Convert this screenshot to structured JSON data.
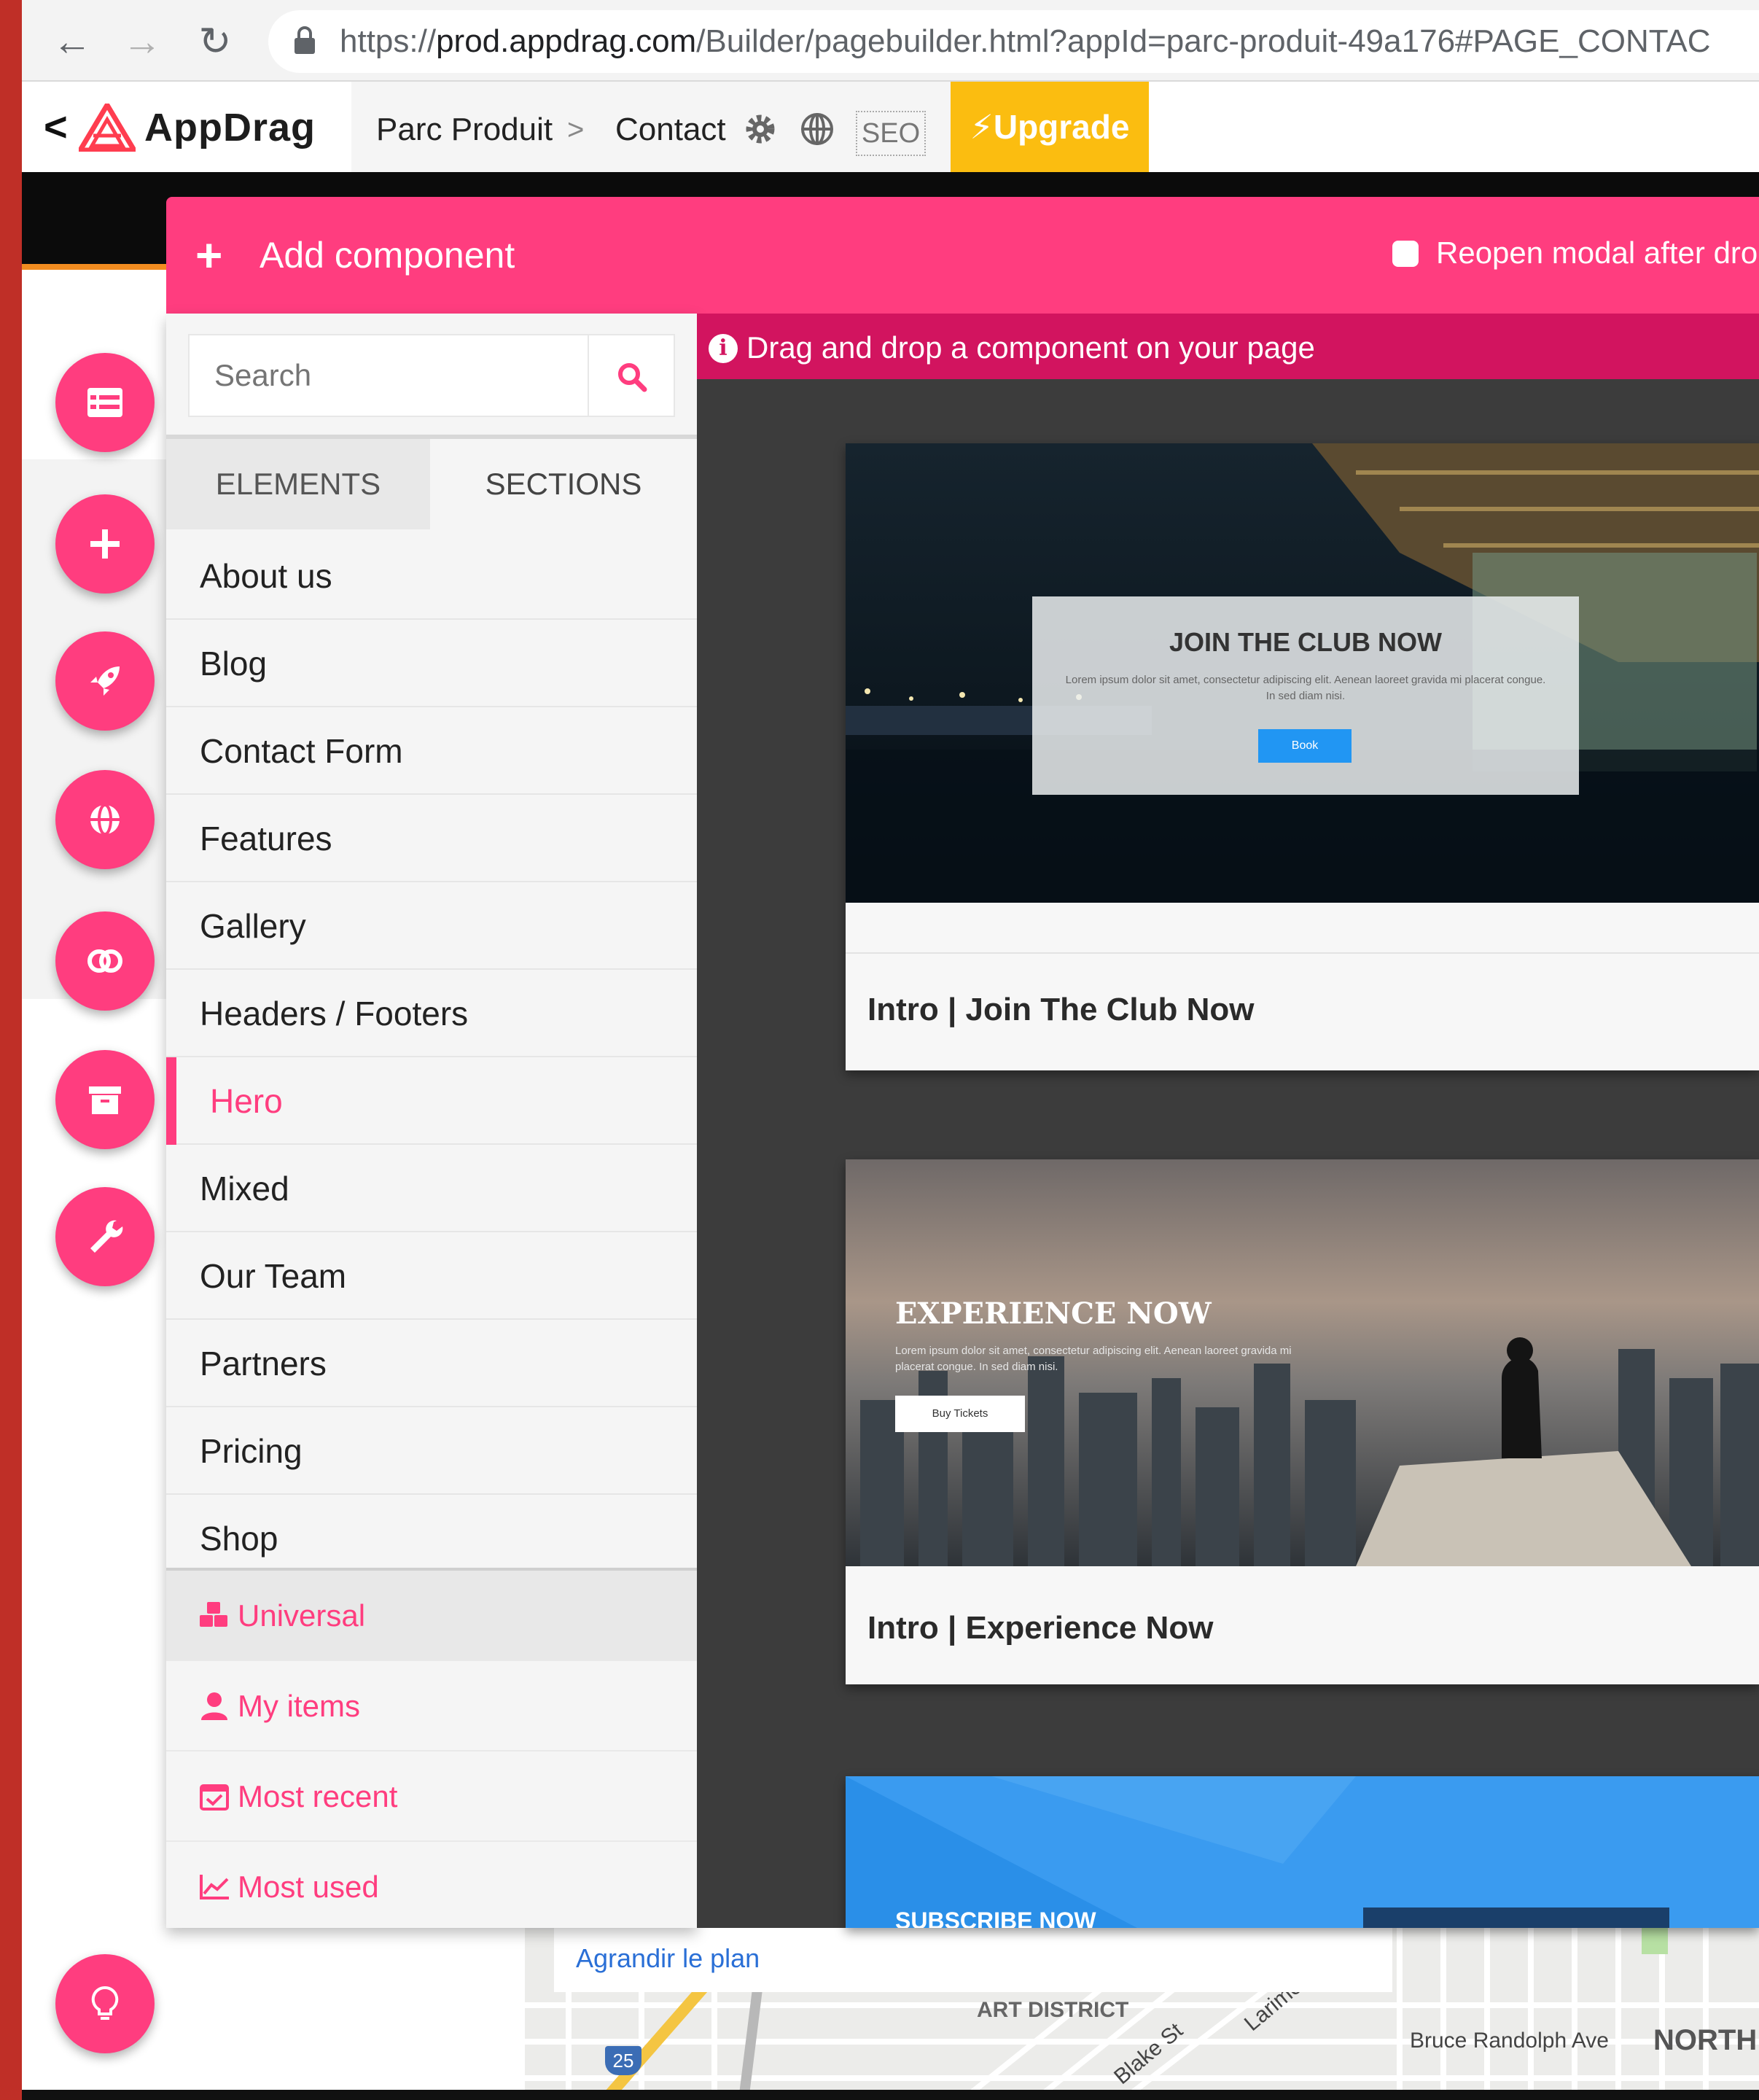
{
  "browser": {
    "url_scheme": "https://",
    "url_host": "prod.appdrag.com",
    "url_path": "/Builder/pagebuilder.html?appId=parc-produit-49a176#PAGE_CONTAC"
  },
  "header": {
    "back_label": "<",
    "logo_text": "AppDrag",
    "crumb_project": "Parc Produit",
    "crumb_separator": ">",
    "crumb_page": "Contact",
    "seo_label": "SEO",
    "upgrade_label": "Upgrade"
  },
  "modal": {
    "plus_glyph": "+",
    "title": "Add component",
    "reopen_label": "Reopen modal after dro"
  },
  "panel": {
    "search_placeholder": "Search",
    "tab_elements": "ELEMENTS",
    "tab_sections": "SECTIONS",
    "categories": [
      "About us",
      "Blog",
      "Contact Form",
      "Features",
      "Gallery",
      "Headers / Footers",
      "Hero",
      "Mixed",
      "Our Team",
      "Partners",
      "Pricing",
      "Shop"
    ],
    "active_category": "Hero",
    "extra": [
      {
        "label": "Universal",
        "icon": "cubes-icon"
      },
      {
        "label": "My items",
        "icon": "user-icon"
      },
      {
        "label": "Most recent",
        "icon": "calendar-check-icon"
      },
      {
        "label": "Most used",
        "icon": "chart-line-icon"
      }
    ]
  },
  "content": {
    "info_glyph": "i",
    "info_text": "Drag and drop a component on your page",
    "cards": [
      {
        "title": "Intro | Join The Club Now",
        "preview_heading": "JOIN THE CLUB NOW",
        "preview_body": "Lorem ipsum dolor sit amet, consectetur adipiscing elit. Aenean laoreet gravida mi placerat congue. In sed diam nisi.",
        "preview_button": "Book"
      },
      {
        "title": "Intro | Experience Now",
        "preview_heading": "EXPERIENCE NOW",
        "preview_body": "Lorem ipsum dolor sit amet, consectetur adipiscing elit. Aenean laoreet gravida mi placerat congue. In sed diam nisi.",
        "preview_button": "Buy Tickets"
      },
      {
        "title": "",
        "preview_heading": "SUBSCRIBE NOW"
      }
    ]
  },
  "map": {
    "link": "Agrandir le plan",
    "labels": [
      "Bruce Randolph Ave",
      "NORTH",
      "Blake St",
      "Larimer",
      "ART DISTRICT",
      "25"
    ]
  },
  "colors": {
    "accent": "#ff3d7f",
    "info_bar": "#d2145f",
    "upgrade": "#fbbd10",
    "content_bg": "#3c3c3c"
  }
}
